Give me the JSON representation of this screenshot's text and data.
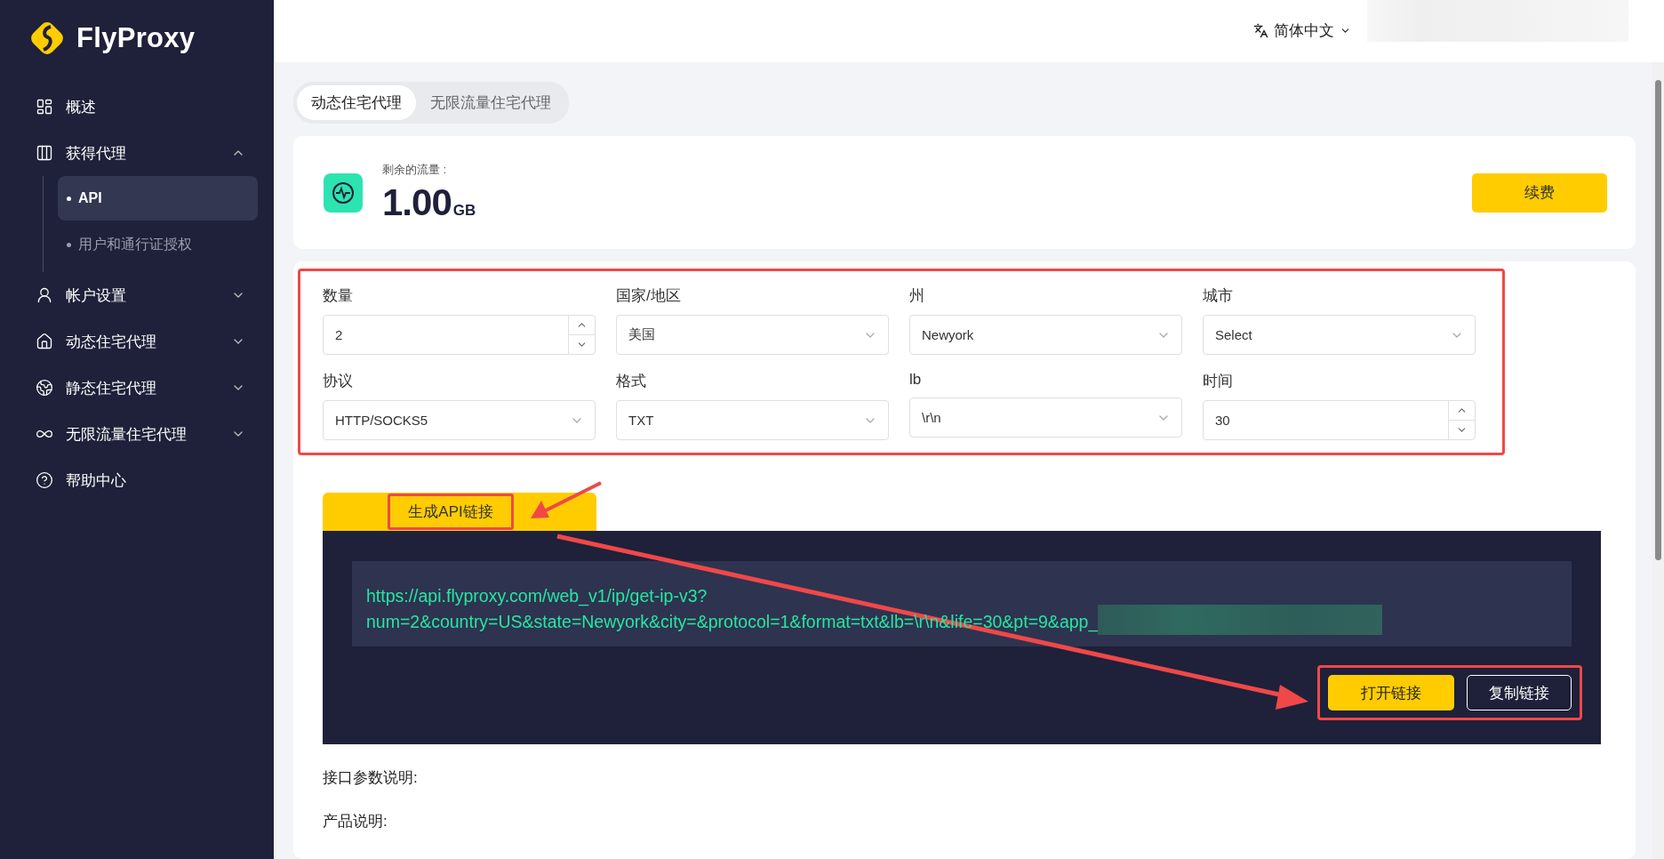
{
  "sidebar": {
    "logo": "FlyProxy",
    "items": [
      {
        "label": "概述"
      },
      {
        "label": "获得代理",
        "expanded": true,
        "children": [
          {
            "label": "API",
            "selected": true
          },
          {
            "label": "用户和通行证授权",
            "selected": false
          }
        ]
      },
      {
        "label": "帐户设置",
        "expanded": false
      },
      {
        "label": "动态住宅代理",
        "expanded": false
      },
      {
        "label": "静态住宅代理",
        "expanded": false
      },
      {
        "label": "无限流量住宅代理",
        "expanded": false
      },
      {
        "label": "帮助中心"
      }
    ]
  },
  "header": {
    "language": "简体中文"
  },
  "tabs": [
    {
      "label": "动态住宅代理",
      "selected": true
    },
    {
      "label": "无限流量住宅代理",
      "selected": false
    }
  ],
  "balance": {
    "label": "剩余的流量 :",
    "value": "1.00",
    "unit": "GB",
    "button": "续费"
  },
  "form": {
    "highlighted": true,
    "fields": [
      {
        "label": "数量",
        "kind": "number",
        "value": "2"
      },
      {
        "label": "国家/地区",
        "kind": "select",
        "value": "美国"
      },
      {
        "label": "州",
        "kind": "select",
        "value": "Newyork"
      },
      {
        "label": "城市",
        "kind": "select",
        "value": "Select"
      },
      {
        "label": "协议",
        "kind": "select",
        "value": "HTTP/SOCKS5"
      },
      {
        "label": "格式",
        "kind": "select",
        "value": "TXT"
      },
      {
        "label": "lb",
        "kind": "select",
        "value": "\\r\\n"
      },
      {
        "label": "时间",
        "kind": "number",
        "value": "30"
      }
    ]
  },
  "generate": {
    "label": "生成API链接",
    "highlighted": true
  },
  "result": {
    "url_lines": [
      "https://api.flyproxy.com/web_v1/ip/get-ip-v3?",
      "num=2&country=US&state=Newyork&city=&protocol=1&format=txt&lb=\\r\\n&life=30&pt=9&app_"
    ],
    "actions": {
      "highlighted": true,
      "buttons": [
        {
          "label": "打开链接",
          "kind": "primary"
        },
        {
          "label": "复制链接",
          "kind": "outline"
        }
      ]
    }
  },
  "docs": [
    "接口参数说明:",
    "产品说明:"
  ]
}
